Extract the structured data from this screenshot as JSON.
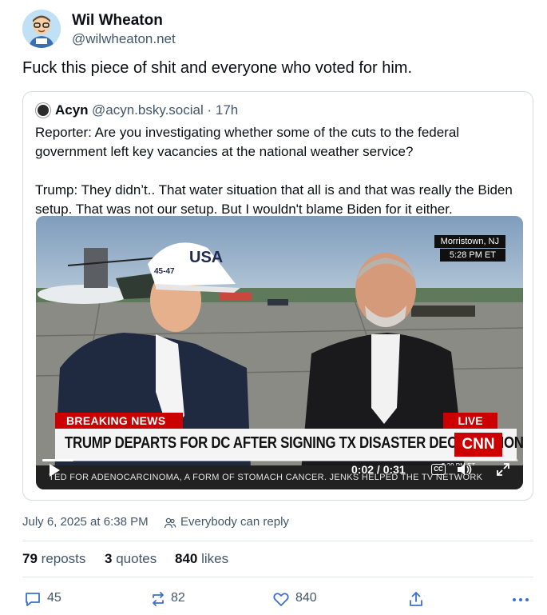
{
  "author": {
    "name": "Wil Wheaton",
    "handle": "@wilwheaton.net"
  },
  "post": {
    "text": "Fuck this piece of shit and everyone who voted for him."
  },
  "quoted": {
    "name": "Acyn",
    "handle": "@acyn.bsky.social · 17h",
    "text": "Reporter: Are you investigating whether some of the cuts to the federal government left key vacancies at the national weather service?\n\nTrump: They didn’t.. That water situation that all is and that was really the Biden setup. That was not our setup. But I wouldn't blame Biden for it either.",
    "video": {
      "location": "Morristown, NJ",
      "local_time": "5:28 PM ET",
      "breaking_label": "BREAKING NEWS",
      "live_label": "LIVE",
      "headline": "TRUMP DEPARTS FOR DC AFTER SIGNING TX DISASTER DECLARATION",
      "network": "CNN",
      "network_time": "5:29 PM ET",
      "ticker": "TED FOR ADENOCARCINOMA, A FORM OF STOMACH CANCER. JENKS HELPED THE TV NETWORK",
      "playback": "0:02 / 0:31",
      "progress": 0.065,
      "cc_label": "CC",
      "hat_text": "USA",
      "hat_side": "45-47"
    }
  },
  "meta": {
    "timestamp": "July 6, 2025 at 6:38 PM",
    "reply_setting": "Everybody can reply"
  },
  "stats": {
    "reposts_count": "79",
    "reposts_label": "reposts",
    "quotes_count": "3",
    "quotes_label": "quotes",
    "likes_count": "840",
    "likes_label": "likes"
  },
  "actions": {
    "replies": "45",
    "reposts": "82",
    "likes": "840"
  },
  "colors": {
    "muted": "#42576c",
    "cnn_red": "#cc0000",
    "border": "#d4dbe2"
  }
}
